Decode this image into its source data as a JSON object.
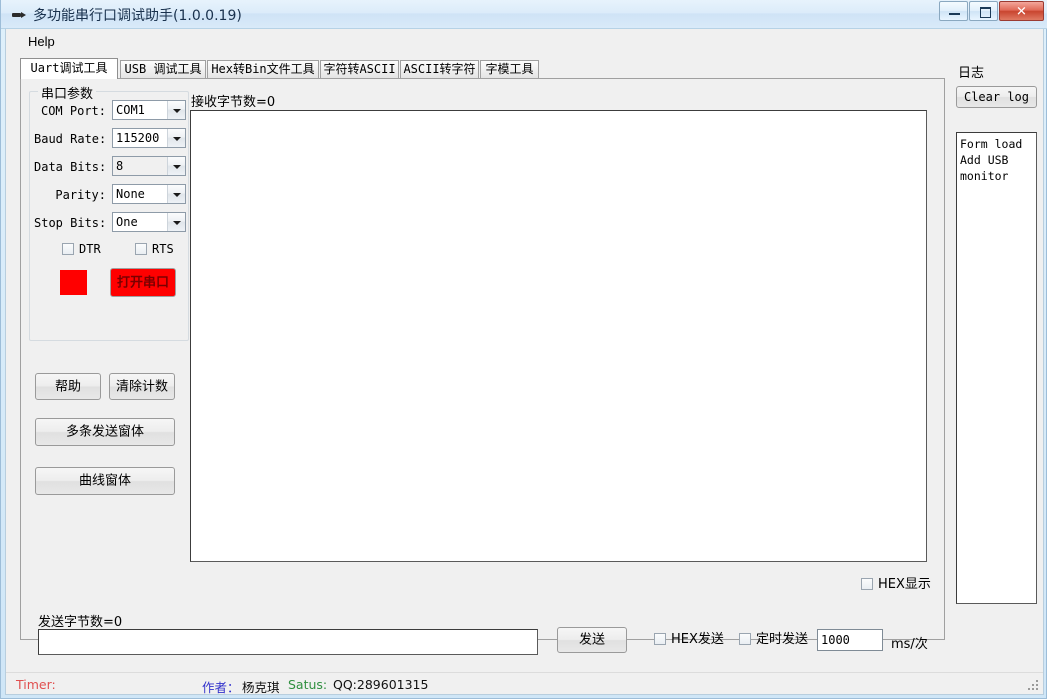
{
  "window": {
    "title": "多功能串行口调试助手(1.0.0.19)",
    "icon": "serial-plug-icon",
    "buttons": {
      "minimize": "minimize-icon",
      "maximize": "maximize-icon",
      "close": "✕"
    }
  },
  "menu": {
    "items": [
      "Help"
    ]
  },
  "tabs": [
    {
      "label": "Uart调试工具",
      "active": true
    },
    {
      "label": "USB 调试工具",
      "active": false
    },
    {
      "label": "Hex转Bin文件工具",
      "active": false
    },
    {
      "label": "字符转ASCII",
      "active": false
    },
    {
      "label": "ASCII转字符",
      "active": false
    },
    {
      "label": "字模工具",
      "active": false
    }
  ],
  "serial_params": {
    "group_title": "串口参数",
    "fields": [
      {
        "label": "COM Port:",
        "value": "COM1"
      },
      {
        "label": "Baud Rate:",
        "value": "115200"
      },
      {
        "label": "Data Bits:",
        "value": "8"
      },
      {
        "label": "Parity:",
        "value": "None"
      },
      {
        "label": "Stop Bits:",
        "value": "One"
      }
    ],
    "dtr_label": "DTR",
    "rts_label": "RTS",
    "status_color": "#ff0000",
    "open_button": "打开串口"
  },
  "left_buttons": {
    "help": "帮助",
    "clear_count": "清除计数",
    "multi_send": "多条发送窗体",
    "curve_window": "曲线窗体"
  },
  "receive": {
    "count_label": "接收字节数=0",
    "content": "",
    "hex_display_label": "HEX显示",
    "hex_display_checked": false
  },
  "send": {
    "count_label": "发送字节数=0",
    "input_value": "",
    "send_button": "发送",
    "hex_send_label": "HEX发送",
    "hex_send_checked": false,
    "timed_send_label": "定时发送",
    "timed_send_checked": false,
    "interval_value": "1000",
    "interval_unit": "ms/次"
  },
  "log": {
    "title": "日志",
    "clear_button": "Clear log",
    "lines": [
      "Form load",
      "Add USB",
      "monitor"
    ]
  },
  "statusbar": {
    "timer_label": "Timer:",
    "timer_color": "#e05050",
    "author_label": "作者：",
    "author_color": "#3333cc",
    "author_name": "杨克琪",
    "status_label": "Satus:",
    "status_color": "#2f8f3f",
    "qq": "QQ:289601315"
  }
}
